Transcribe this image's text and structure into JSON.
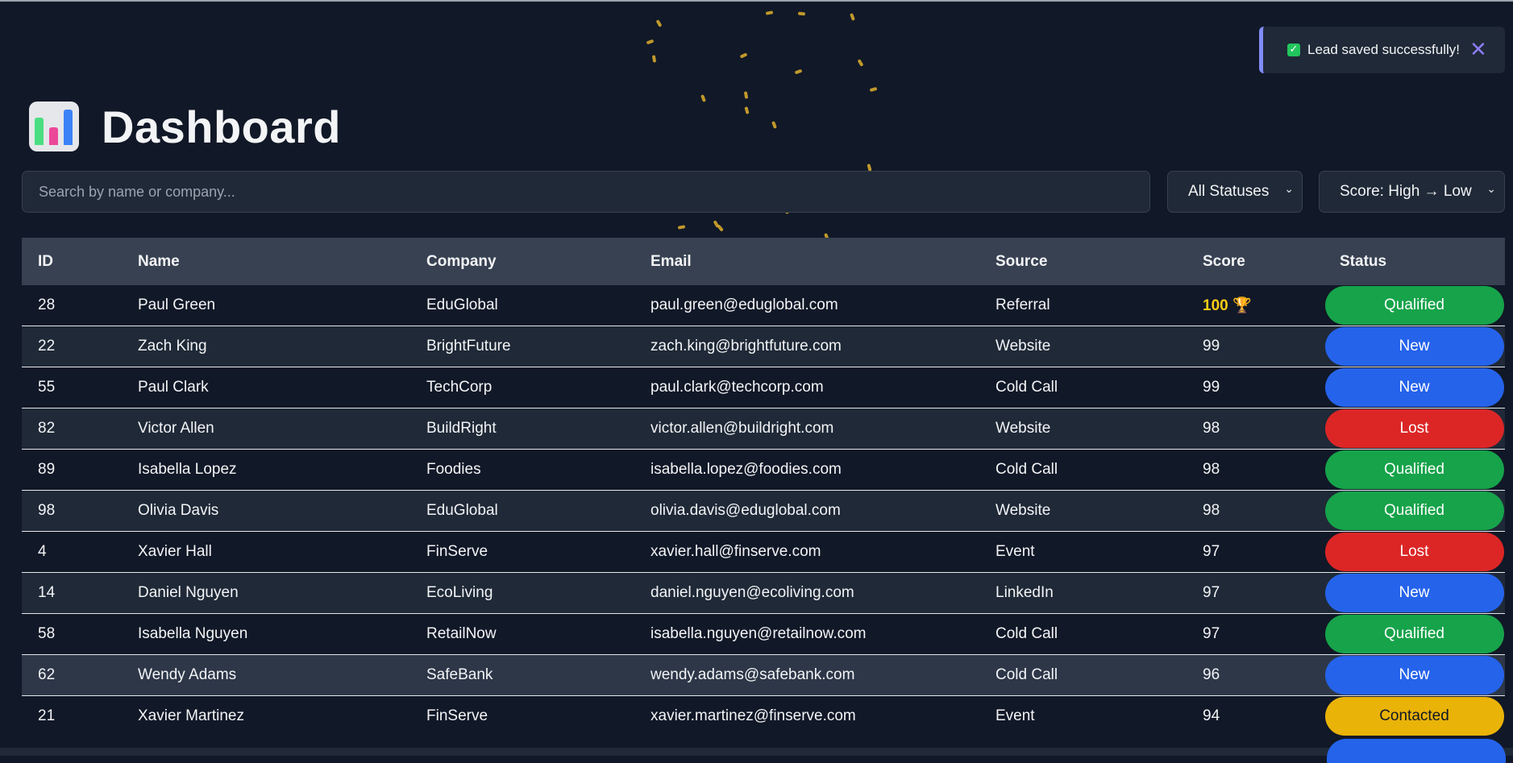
{
  "toast": {
    "message": "Lead saved successfully!",
    "check_icon": "✓",
    "close_icon": "✕"
  },
  "header": {
    "title": "Dashboard",
    "icon": "bar-chart-icon"
  },
  "controls": {
    "search_placeholder": "Search by name or company...",
    "status_filter": "All Statuses",
    "sort": "Score: High → Low"
  },
  "colors": {
    "qualified": "#16a34a",
    "new": "#2563eb",
    "lost": "#dc2626",
    "contacted": "#eab308",
    "top_score": "#facc15",
    "toast_border": "#818cf8"
  },
  "table": {
    "columns": [
      "ID",
      "Name",
      "Company",
      "Email",
      "Source",
      "Score",
      "Status"
    ],
    "rows": [
      {
        "id": "28",
        "name": "Paul Green",
        "company": "EduGlobal",
        "email": "paul.green@eduglobal.com",
        "source": "Referral",
        "score": "100 🏆",
        "status": "Qualified"
      },
      {
        "id": "22",
        "name": "Zach King",
        "company": "BrightFuture",
        "email": "zach.king@brightfuture.com",
        "source": "Website",
        "score": "99",
        "status": "New"
      },
      {
        "id": "55",
        "name": "Paul Clark",
        "company": "TechCorp",
        "email": "paul.clark@techcorp.com",
        "source": "Cold Call",
        "score": "99",
        "status": "New"
      },
      {
        "id": "82",
        "name": "Victor Allen",
        "company": "BuildRight",
        "email": "victor.allen@buildright.com",
        "source": "Website",
        "score": "98",
        "status": "Lost"
      },
      {
        "id": "89",
        "name": "Isabella Lopez",
        "company": "Foodies",
        "email": "isabella.lopez@foodies.com",
        "source": "Cold Call",
        "score": "98",
        "status": "Qualified"
      },
      {
        "id": "98",
        "name": "Olivia Davis",
        "company": "EduGlobal",
        "email": "olivia.davis@eduglobal.com",
        "source": "Website",
        "score": "98",
        "status": "Qualified"
      },
      {
        "id": "4",
        "name": "Xavier Hall",
        "company": "FinServe",
        "email": "xavier.hall@finserve.com",
        "source": "Event",
        "score": "97",
        "status": "Lost"
      },
      {
        "id": "14",
        "name": "Daniel Nguyen",
        "company": "EcoLiving",
        "email": "daniel.nguyen@ecoliving.com",
        "source": "LinkedIn",
        "score": "97",
        "status": "New"
      },
      {
        "id": "58",
        "name": "Isabella Nguyen",
        "company": "RetailNow",
        "email": "isabella.nguyen@retailnow.com",
        "source": "Cold Call",
        "score": "97",
        "status": "Qualified"
      },
      {
        "id": "62",
        "name": "Wendy Adams",
        "company": "SafeBank",
        "email": "wendy.adams@safebank.com",
        "source": "Cold Call",
        "score": "96",
        "status": "New"
      },
      {
        "id": "21",
        "name": "Xavier Martinez",
        "company": "FinServe",
        "email": "xavier.martinez@finserve.com",
        "source": "Event",
        "score": "94",
        "status": "Contacted"
      }
    ]
  }
}
